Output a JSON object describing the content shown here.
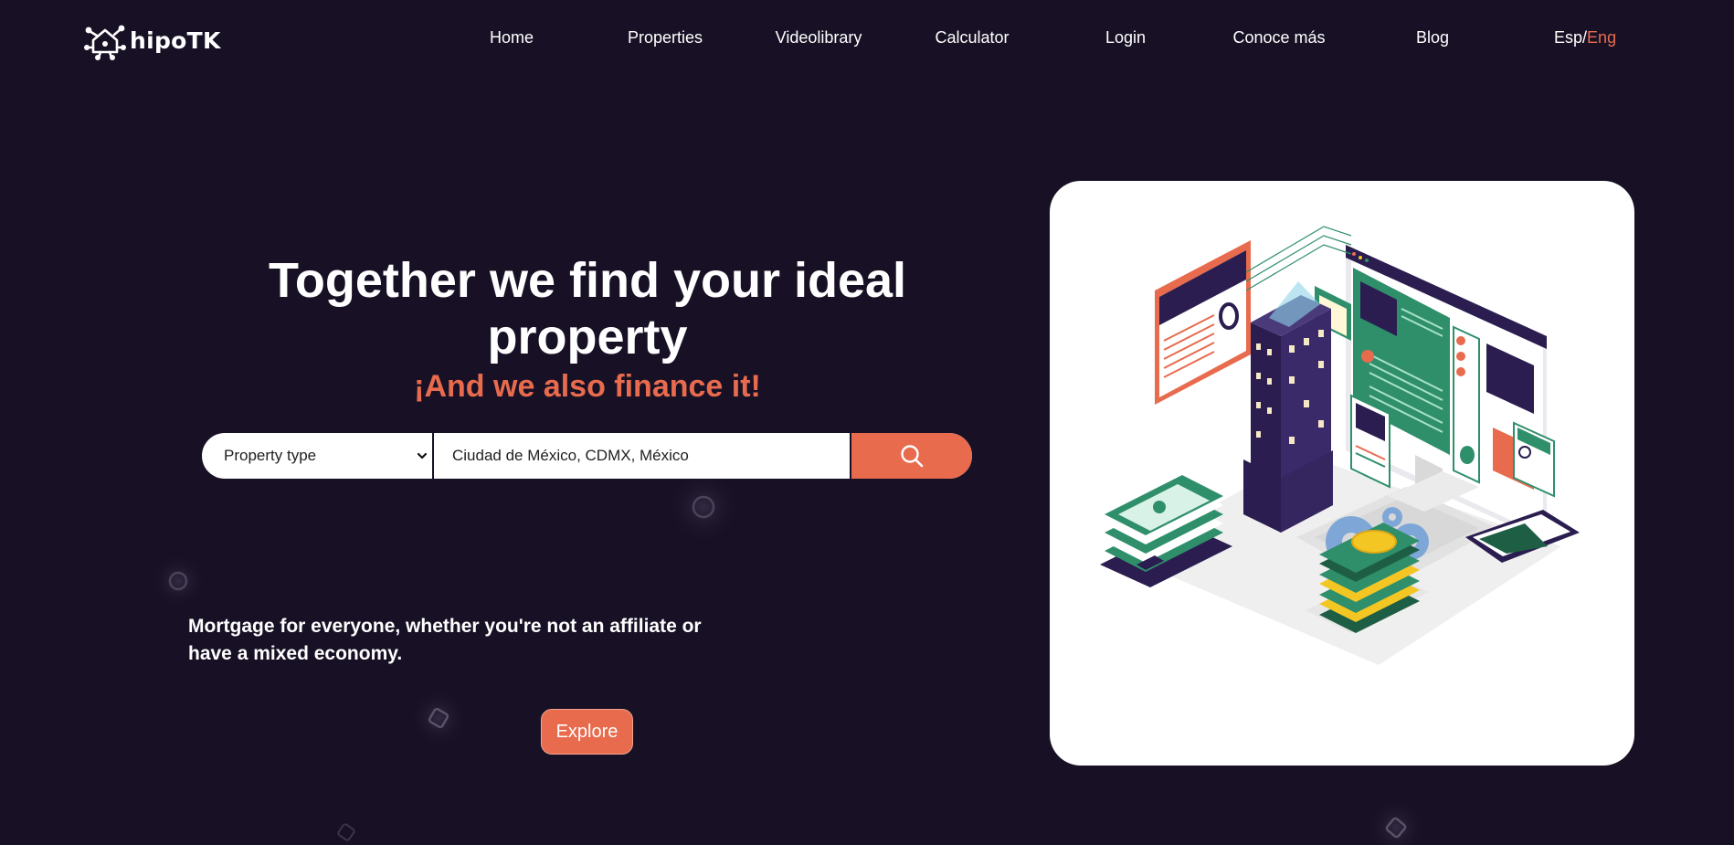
{
  "header": {
    "logo_text": "hipoTK",
    "nav": [
      {
        "label": "Home"
      },
      {
        "label": "Properties"
      },
      {
        "label": "Videolibrary"
      },
      {
        "label": "Calculator"
      },
      {
        "label": "Login"
      },
      {
        "label": "Conoce más"
      },
      {
        "label": "Blog"
      }
    ],
    "lang": {
      "esp": "Esp",
      "separator": "/",
      "eng": "Eng",
      "active": "Eng"
    }
  },
  "hero": {
    "title": "Together we find your ideal property",
    "subtitle": "¡And we also finance it!",
    "search": {
      "property_type_selected": "Property type",
      "location_value": "Ciudad de México, CDMX, México",
      "search_icon": "search-icon"
    },
    "tagline": "Mortgage for everyone, whether you're not an affiliate or have a mixed economy.",
    "explore_label": "Explore"
  },
  "colors": {
    "background": "#181125",
    "accent": "#e86b4e",
    "text": "#ffffff",
    "illustration_green": "#2f8f6b",
    "illustration_purple": "#2b1d4f"
  }
}
